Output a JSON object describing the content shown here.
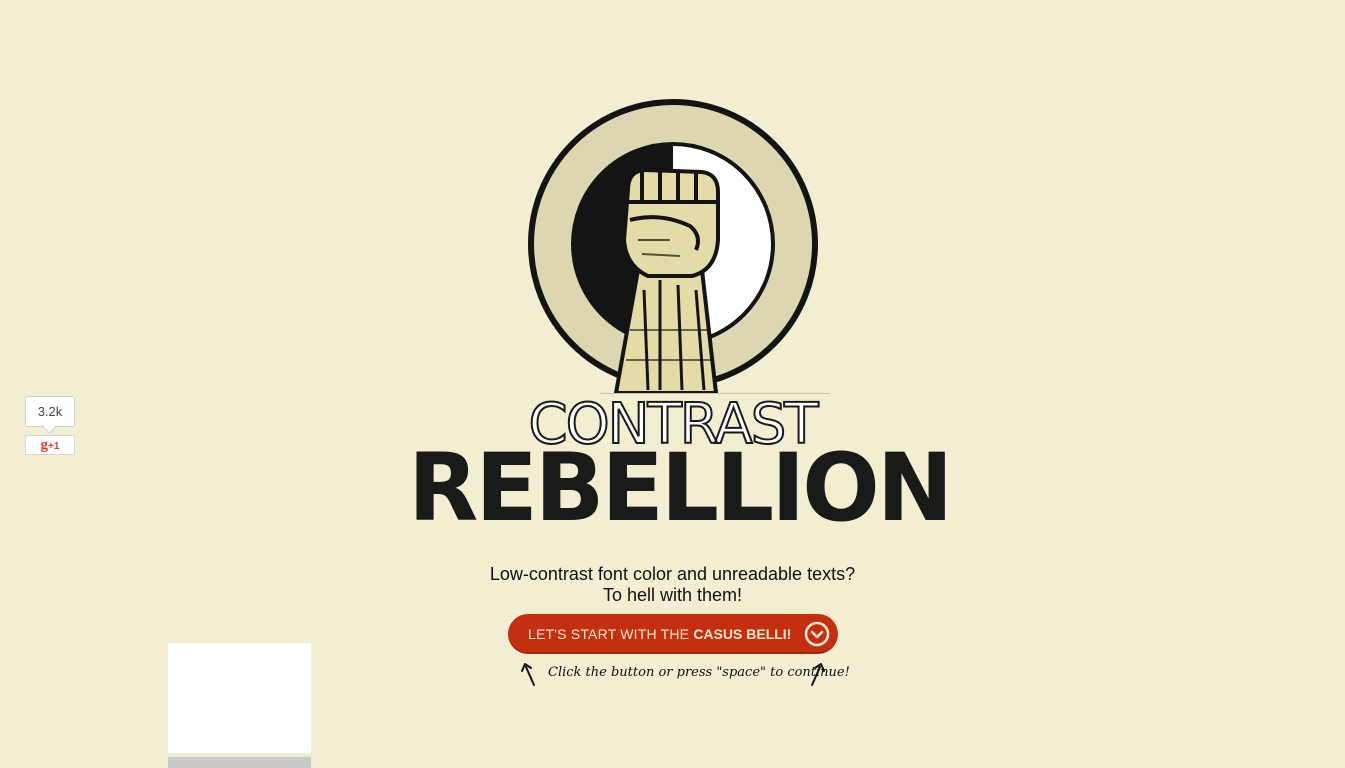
{
  "social": {
    "share_count": "3.2k",
    "gplus_label_g": "g",
    "gplus_label_plus": "+1"
  },
  "logo": {
    "icon": "raised-fist-icon",
    "title_top": "CONTRAST",
    "title_main": "REBELLION"
  },
  "intro": {
    "line1": "Low-contrast font color and unreadable texts?",
    "line2": "To hell with them!"
  },
  "cta": {
    "label_prefix": "LET'S START WITH THE ",
    "label_strong": "CASUS BELLI!",
    "icon": "chevron-down-circle-icon"
  },
  "hint": {
    "text": "Click the button or press \"space\" to continue!"
  },
  "colors": {
    "background": "#f1eed1",
    "accent": "#c4300f",
    "ink": "#1a1a19",
    "ring": "#ddd7b1"
  }
}
